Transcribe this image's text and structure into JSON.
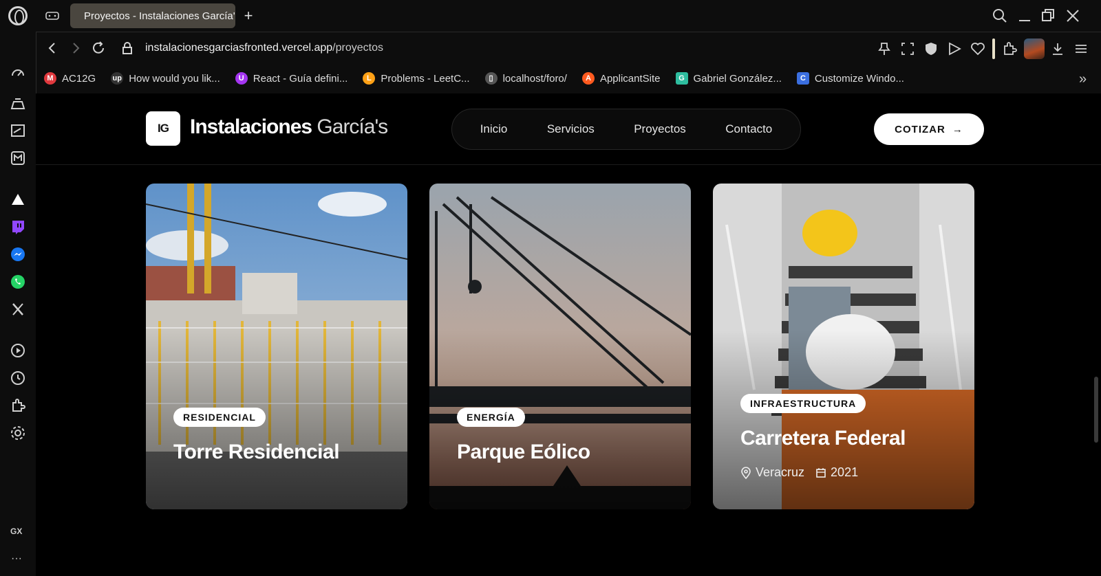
{
  "browser": {
    "tab_title": "Proyectos - Instalaciones García's",
    "new_tab_symbol": "+",
    "url_host": "instalacionesgarciasfronted.vercel.app",
    "url_path": "/proyectos",
    "bookmarks": [
      {
        "label": "AC12G",
        "icon_text": "M",
        "color": "#e0393e"
      },
      {
        "label": "How would you lik...",
        "icon_text": "up",
        "color": "#333333"
      },
      {
        "label": "React - Guía defini...",
        "icon_text": "U",
        "color": "#a435f0"
      },
      {
        "label": "Problems - LeetC...",
        "icon_text": "L",
        "color": "#ffa116"
      },
      {
        "label": "localhost/foro/",
        "icon_text": "▯",
        "color": "#555555"
      },
      {
        "label": "ApplicantSite",
        "icon_text": "A",
        "color": "#ff5a1f"
      },
      {
        "label": "Gabriel González...",
        "icon_text": "G",
        "color": "#2ebd9f"
      },
      {
        "label": "Customize Windo...",
        "icon_text": "C",
        "color": "#3b6fe0"
      }
    ],
    "sidebar_footer_label": "GX",
    "sidebar_more": "···"
  },
  "site": {
    "logo_initials": "IG",
    "brand_bold": "Instalaciones",
    "brand_light": "García's",
    "nav": [
      "Inicio",
      "Servicios",
      "Proyectos",
      "Contacto"
    ],
    "cta_label": "COTIZAR",
    "cta_arrow": "→"
  },
  "projects": [
    {
      "category": "RESIDENCIAL",
      "title": "Torre Residencial"
    },
    {
      "category": "ENERGÍA",
      "title": "Parque Eólico"
    },
    {
      "category": "INFRAESTRUCTURA",
      "title": "Carretera Federal",
      "location": "Veracruz",
      "year": "2021"
    }
  ],
  "icons": {
    "tab": "bulb-icon",
    "location": "map-pin-icon",
    "calendar": "calendar-icon"
  }
}
